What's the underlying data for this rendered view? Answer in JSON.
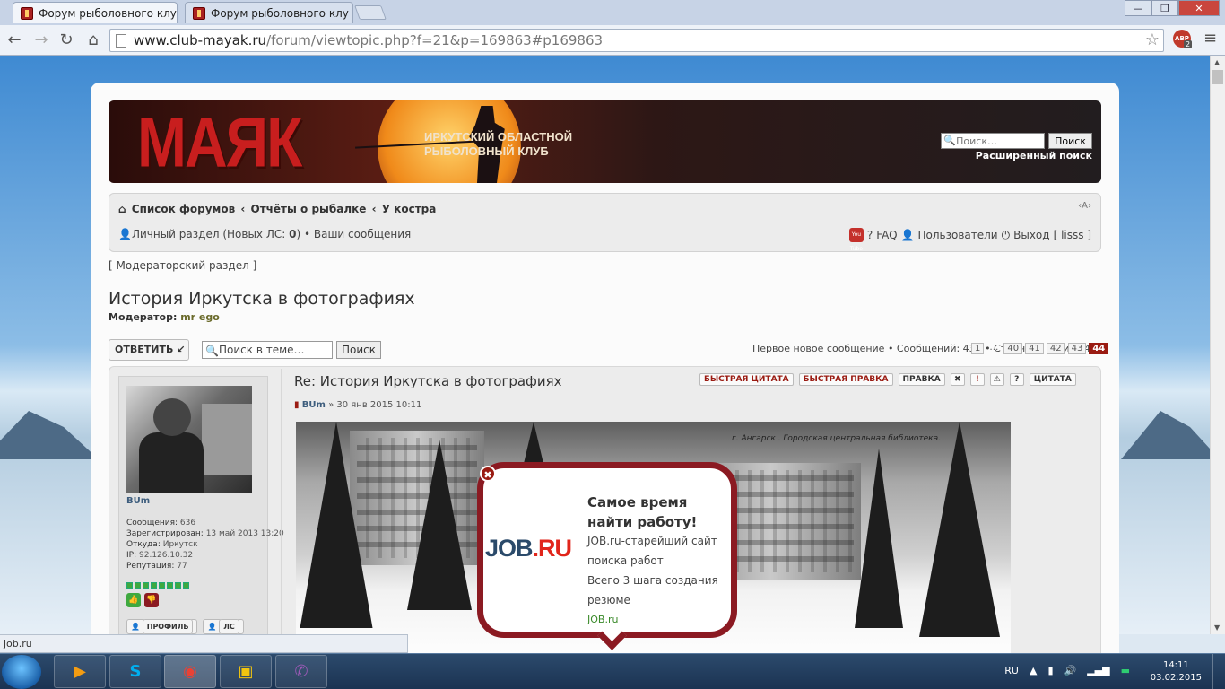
{
  "browser": {
    "tabs": [
      {
        "title": "Форум рыболовного клу",
        "close": "×"
      },
      {
        "title": "Форум рыболовного клу",
        "close": "×"
      }
    ],
    "window_buttons": {
      "minimize": "—",
      "maximize": "❐",
      "close": "✕"
    },
    "nav": {
      "back": "←",
      "forward": "→",
      "reload": "↻",
      "home": "⌂"
    },
    "url_host": "www.club-mayak.ru",
    "url_path": "/forum/viewtopic.php?f=21&p=169863#p169863",
    "star": "☆",
    "abp_label": "ABP",
    "abp_count": "2",
    "menu": "≡"
  },
  "header": {
    "logo": "МАЯК",
    "slogan_line1": "Иркутский областной",
    "slogan_line2": "рыболовный клуб",
    "search_placeholder": "Поиск…",
    "search_button": "Поиск",
    "advanced_search": "Расширенный поиск"
  },
  "navbar": {
    "breadcrumbs": [
      "Список форумов",
      "Отчёты о рыбалке",
      "У костра"
    ],
    "crumb_sep": "‹",
    "font_size_controls": "‹A›",
    "user_section": "Личный раздел",
    "new_pm_label": "Новых ЛС:",
    "new_pm_count": "0",
    "my_posts": "Ваши сообщения",
    "youtube": "You Tube",
    "faq": "FAQ",
    "users": "Пользователи",
    "logout": "Выход",
    "username": "lisss"
  },
  "moderator_section": "[ Модераторский раздел ]",
  "topic": {
    "title": "История Иркутска в фотографиях",
    "moderator_label": "Модератор:",
    "moderator_name": "mr ego",
    "reply_button": "ОТВЕТИТЬ",
    "search_placeholder": "Поиск в теме…",
    "search_button": "Поиск",
    "page_info": "Первое новое сообщение • Сообщений: 436 • Страница 44 из 44 •",
    "pages": [
      "1",
      "…",
      "40",
      "41",
      "42",
      "43",
      "44"
    ],
    "current_page": "44"
  },
  "post": {
    "title": "Re: История Иркутска в фотографиях",
    "author": "BUm",
    "date": "» 30 янв 2015 10:11",
    "buttons": {
      "quick_quote": "БЫСТРАЯ ЦИТАТА",
      "quick_edit": "БЫСТРАЯ ПРАВКА",
      "edit": "ПРАВКА",
      "quote": "ЦИТАТА"
    },
    "icons": [
      "✖",
      "!",
      "⚠",
      "?"
    ],
    "photo_caption": "г. Ангарск . Городская центральная библиотека."
  },
  "profile": {
    "username": "BUm",
    "posts_label": "Сообщения:",
    "posts": "636",
    "registered_label": "Зарегистрирован:",
    "registered": "13 май 2013 13:20",
    "from_label": "Откуда:",
    "from": "Иркутск",
    "ip_label": "IP:",
    "ip": "92.126.10.32",
    "rep_label": "Репутация:",
    "rep": "77",
    "rep_bars": 8,
    "profile_button": "ПРОФИЛЬ",
    "pm_button": "ЛС"
  },
  "ad": {
    "close": "✖",
    "logo_job": "JOB",
    "logo_ru": ".RU",
    "title_line1": "Самое время",
    "title_line2": "найти работу!",
    "text1": "JOB.ru-старейший сайт поиска работ",
    "text2": "Всего 3 шага создания резюме",
    "link": "JOB.ru"
  },
  "statusbar": "job.ru",
  "taskbar": {
    "language": "RU",
    "time": "14:11",
    "date": "03.02.2015",
    "apps": [
      "media-player",
      "skype",
      "chrome",
      "explorer",
      "viber"
    ]
  },
  "colors": {
    "brand_red": "#9a1b12",
    "popup_border": "#8b1a22",
    "username_blue": "#3d5d7d"
  }
}
